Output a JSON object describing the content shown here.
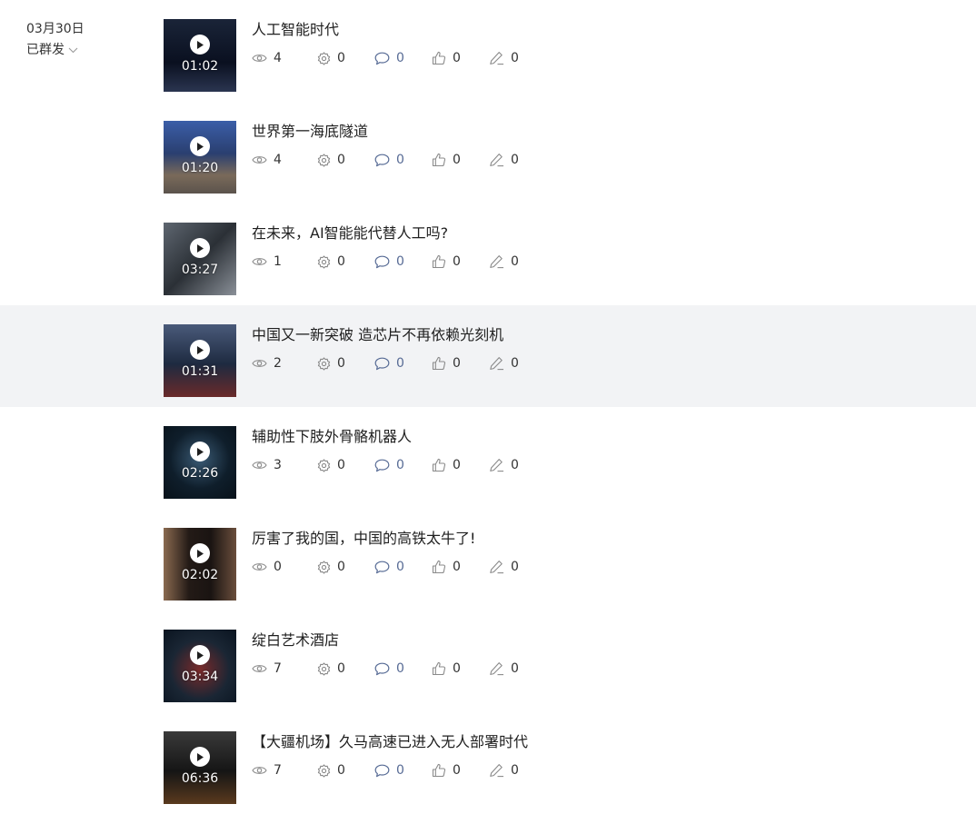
{
  "group": {
    "date": "03月30日",
    "status": "已群发"
  },
  "colors": {
    "highlight_row": "#f2f3f5",
    "link_blue": "#576b95",
    "icon_gray": "#8a8a8a"
  },
  "icons": {
    "views": "eye-icon",
    "shares": "gear-icon",
    "comments": "comment-icon",
    "likes": "thumbs-up-icon",
    "edits": "pencil-icon",
    "play": "play-icon",
    "dropdown": "chevron-down-icon"
  },
  "videos": [
    {
      "title": "人工智能时代",
      "duration": "01:02",
      "views": "4",
      "shares": "0",
      "comments": "0",
      "likes": "0",
      "edits": "0"
    },
    {
      "title": "世界第一海底隧道",
      "duration": "01:20",
      "views": "4",
      "shares": "0",
      "comments": "0",
      "likes": "0",
      "edits": "0"
    },
    {
      "title": "在未来，AI智能能代替人工吗?",
      "duration": "03:27",
      "views": "1",
      "shares": "0",
      "comments": "0",
      "likes": "0",
      "edits": "0"
    },
    {
      "title": "中国又一新突破 造芯片不再依赖光刻机",
      "duration": "01:31",
      "views": "2",
      "shares": "0",
      "comments": "0",
      "likes": "0",
      "edits": "0"
    },
    {
      "title": "辅助性下肢外骨骼机器人",
      "duration": "02:26",
      "views": "3",
      "shares": "0",
      "comments": "0",
      "likes": "0",
      "edits": "0"
    },
    {
      "title": "厉害了我的国，中国的高铁太牛了!",
      "duration": "02:02",
      "views": "0",
      "shares": "0",
      "comments": "0",
      "likes": "0",
      "edits": "0"
    },
    {
      "title": "绽白艺术酒店",
      "duration": "03:34",
      "views": "7",
      "shares": "0",
      "comments": "0",
      "likes": "0",
      "edits": "0"
    },
    {
      "title": "【大疆机场】久马高速已进入无人部署时代",
      "duration": "06:36",
      "views": "7",
      "shares": "0",
      "comments": "0",
      "likes": "0",
      "edits": "0"
    }
  ]
}
